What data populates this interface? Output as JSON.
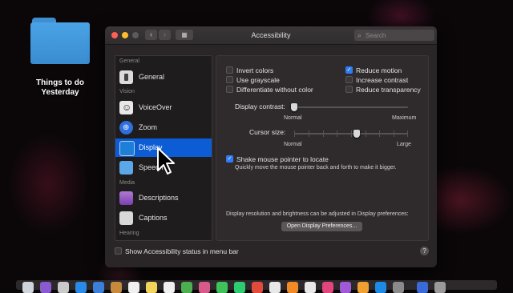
{
  "desktop": {
    "folder_label": "Things to do Yesterday"
  },
  "window": {
    "title": "Accessibility",
    "search_placeholder": "Search"
  },
  "sidebar": {
    "sections": {
      "general": "General",
      "vision": "Vision",
      "media": "Media",
      "hearing": "Hearing"
    },
    "items": [
      {
        "label": "General",
        "icon": "general-icon"
      },
      {
        "label": "VoiceOver",
        "icon": "voiceover-icon"
      },
      {
        "label": "Zoom",
        "icon": "zoom-icon"
      },
      {
        "label": "Display",
        "icon": "display-icon",
        "selected": true
      },
      {
        "label": "Speech",
        "icon": "speech-icon"
      },
      {
        "label": "Descriptions",
        "icon": "descriptions-icon"
      },
      {
        "label": "Captions",
        "icon": "captions-icon"
      }
    ]
  },
  "display": {
    "options_left": [
      {
        "label": "Invert colors",
        "checked": false
      },
      {
        "label": "Use grayscale",
        "checked": false
      },
      {
        "label": "Differentiate without color",
        "checked": false
      }
    ],
    "options_right": [
      {
        "label": "Reduce motion",
        "checked": true
      },
      {
        "label": "Increase contrast",
        "checked": false
      },
      {
        "label": "Reduce transparency",
        "checked": false
      }
    ],
    "contrast": {
      "label": "Display contrast:",
      "min_label": "Normal",
      "max_label": "Maximum",
      "value": 0
    },
    "cursor": {
      "label": "Cursor size:",
      "min_label": "Normal",
      "max_label": "Large",
      "value": 0.55
    },
    "shake": {
      "label": "Shake mouse pointer to locate",
      "checked": true,
      "description": "Quickly move the mouse pointer back and forth to make it bigger."
    },
    "note": "Display resolution and brightness can be adjusted in Display preferences:",
    "open_button": "Open Display Preferences..."
  },
  "footer": {
    "status_label": "Show Accessibility status in menu bar",
    "status_checked": false,
    "help": "?"
  }
}
